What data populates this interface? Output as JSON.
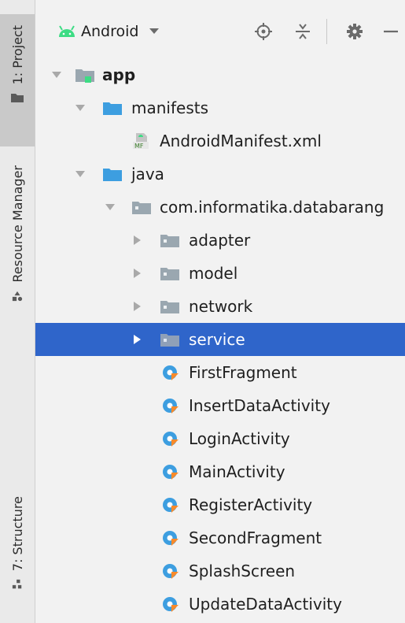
{
  "strip": {
    "project_label": "1: Project",
    "resource_label": "Resource Manager",
    "structure_label": "7: Structure"
  },
  "toolbar": {
    "view_mode": "Android",
    "icons": [
      "android-icon",
      "dropdown-caret-icon",
      "locate-icon",
      "collapse-all-icon",
      "gear-icon",
      "minimize-icon"
    ]
  },
  "tree": {
    "app": "app",
    "manifests": "manifests",
    "android_manifest": "AndroidManifest.xml",
    "manifest_badge": "MF",
    "java": "java",
    "package": "com.informatika.databarang",
    "folders": [
      "adapter",
      "model",
      "network",
      "service"
    ],
    "classes": [
      "FirstFragment",
      "InsertDataActivity",
      "LoginActivity",
      "MainActivity",
      "RegisterActivity",
      "SecondFragment",
      "SplashScreen",
      "UpdateDataActivity"
    ],
    "selected": "service"
  },
  "colors": {
    "selection": "#2f65ca",
    "folder": "#9aa7b0",
    "folder_blue": "#3d9ee0",
    "android_green": "#3ddc84",
    "kotlin_orange": "#f88a2b"
  }
}
